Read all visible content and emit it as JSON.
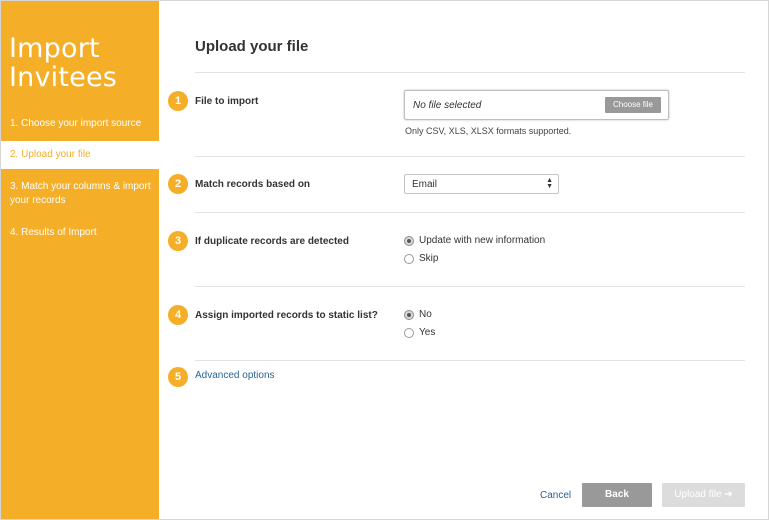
{
  "sidebar": {
    "title": "Import Invitees",
    "steps": [
      {
        "label": "1. Choose your import source"
      },
      {
        "label": "2. Upload your file"
      },
      {
        "label": "3. Match your columns & import your records"
      },
      {
        "label": "4. Results of Import"
      }
    ],
    "active_step": 2,
    "accent_color": "#f5ae27"
  },
  "main": {
    "title": "Upload your file",
    "sections": [
      {
        "number": "1",
        "label": "File to import",
        "file_status": "No file selected",
        "choose_button": "Choose file",
        "help_text": "Only CSV, XLS, XLSX formats supported."
      },
      {
        "number": "2",
        "label": "Match records based on",
        "selected_option": "Email"
      },
      {
        "number": "3",
        "label": "If duplicate records are detected",
        "options": [
          {
            "label": "Update with new information",
            "selected": true
          },
          {
            "label": "Skip",
            "selected": false
          }
        ]
      },
      {
        "number": "4",
        "label": "Assign imported records to static list?",
        "options": [
          {
            "label": "No",
            "selected": true
          },
          {
            "label": "Yes",
            "selected": false
          }
        ]
      },
      {
        "number": "5",
        "link_label": "Advanced options"
      }
    ]
  },
  "footer": {
    "cancel_label": "Cancel",
    "back_label": "Back",
    "upload_label": "Upload file ➔"
  }
}
